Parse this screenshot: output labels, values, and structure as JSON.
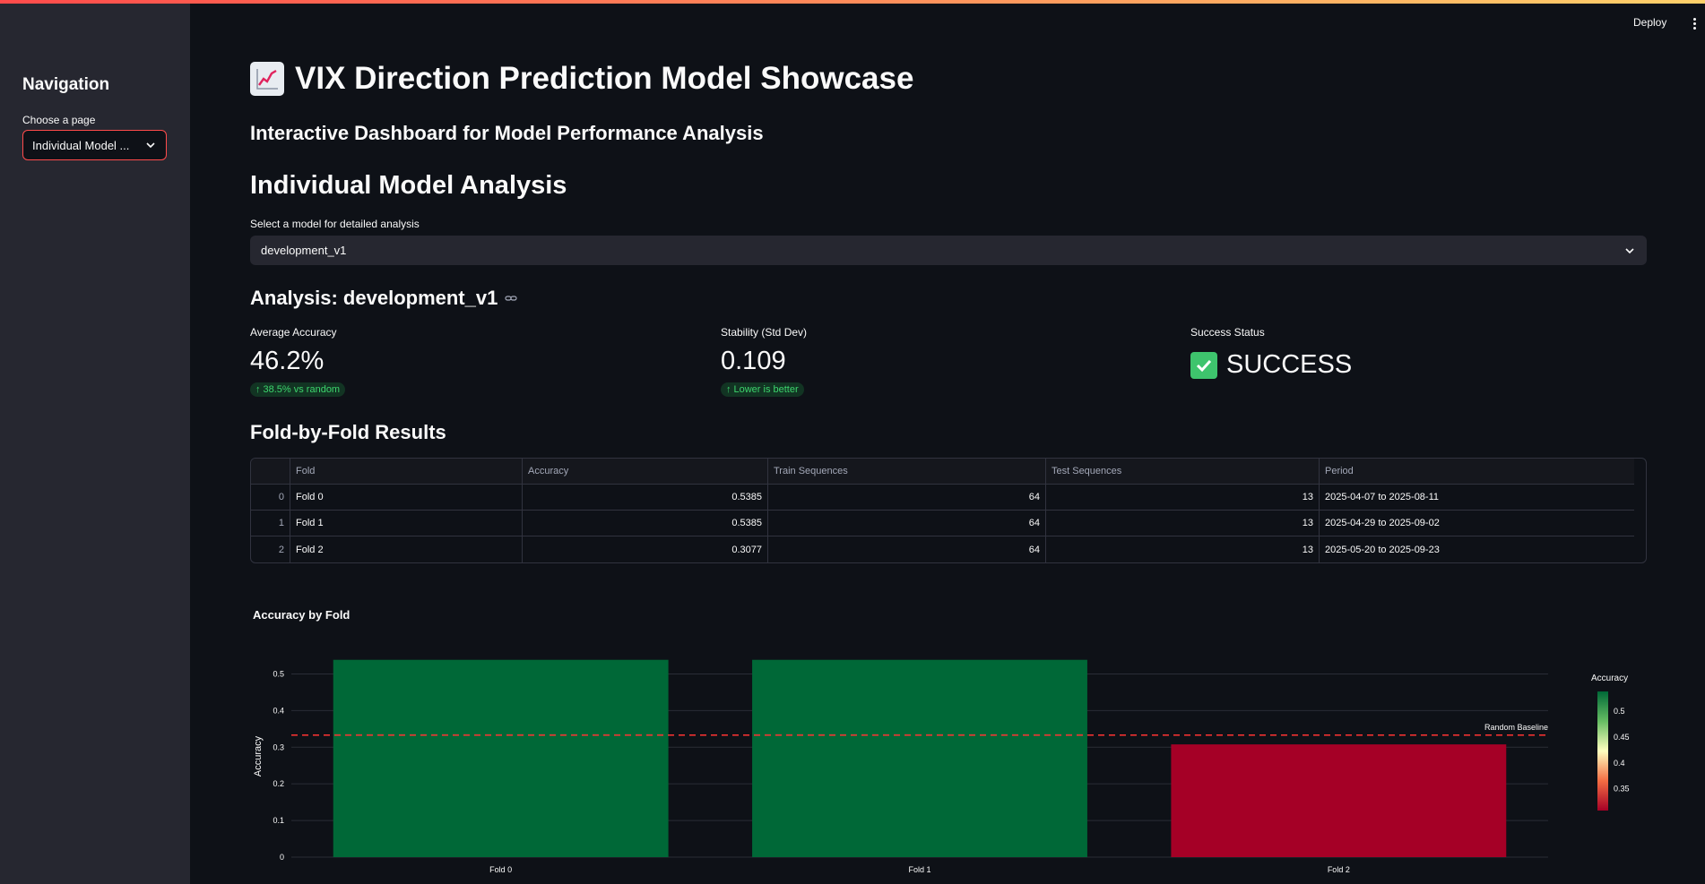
{
  "sidebar": {
    "title": "Navigation",
    "select_label": "Choose a page",
    "select_value": "Individual Model ..."
  },
  "toolbar": {
    "deploy_label": "Deploy"
  },
  "header": {
    "title": "VIX Direction Prediction Model Showcase",
    "subtitle": "Interactive Dashboard for Model Performance Analysis",
    "section_title": "Individual Model Analysis",
    "model_select_label": "Select a model for detailed analysis",
    "model_select_value": "development_v1",
    "analysis_title": "Analysis: development_v1"
  },
  "metrics": [
    {
      "label": "Average Accuracy",
      "value": "46.2%",
      "delta": "38.5% vs random"
    },
    {
      "label": "Stability (Std Dev)",
      "value": "0.109",
      "delta": "Lower is better"
    },
    {
      "label": "Success Status",
      "value": "SUCCESS"
    }
  ],
  "table": {
    "title": "Fold-by-Fold Results",
    "columns": [
      "Fold",
      "Accuracy",
      "Train Sequences",
      "Test Sequences",
      "Period"
    ],
    "rows": [
      {
        "idx": "0",
        "fold": "Fold 0",
        "accuracy": "0.5385",
        "train": "64",
        "test": "13",
        "period": "2025-04-07 to 2025-08-11"
      },
      {
        "idx": "1",
        "fold": "Fold 1",
        "accuracy": "0.5385",
        "train": "64",
        "test": "13",
        "period": "2025-04-29 to 2025-09-02"
      },
      {
        "idx": "2",
        "fold": "Fold 2",
        "accuracy": "0.3077",
        "train": "64",
        "test": "13",
        "period": "2025-05-20 to 2025-09-23"
      }
    ]
  },
  "chart_data": {
    "type": "bar",
    "title": "Accuracy by Fold",
    "categories": [
      "Fold 0",
      "Fold 1",
      "Fold 2"
    ],
    "values": [
      0.5385,
      0.5385,
      0.3077
    ],
    "xlabel": "",
    "ylabel": "Accuracy",
    "ylim": [
      0,
      0.55
    ],
    "yticks": [
      0,
      0.1,
      0.2,
      0.3,
      0.4,
      0.5
    ],
    "baseline": {
      "value": 0.333,
      "label": "Random Baseline",
      "color": "#ff3333"
    },
    "colorbar": {
      "title": "Accuracy",
      "ticks": [
        0.35,
        0.4,
        0.45,
        0.5
      ],
      "range": [
        0.3077,
        0.5385
      ]
    },
    "colors": {
      "high": "#006837",
      "low": "#a50026"
    },
    "grid": true
  }
}
